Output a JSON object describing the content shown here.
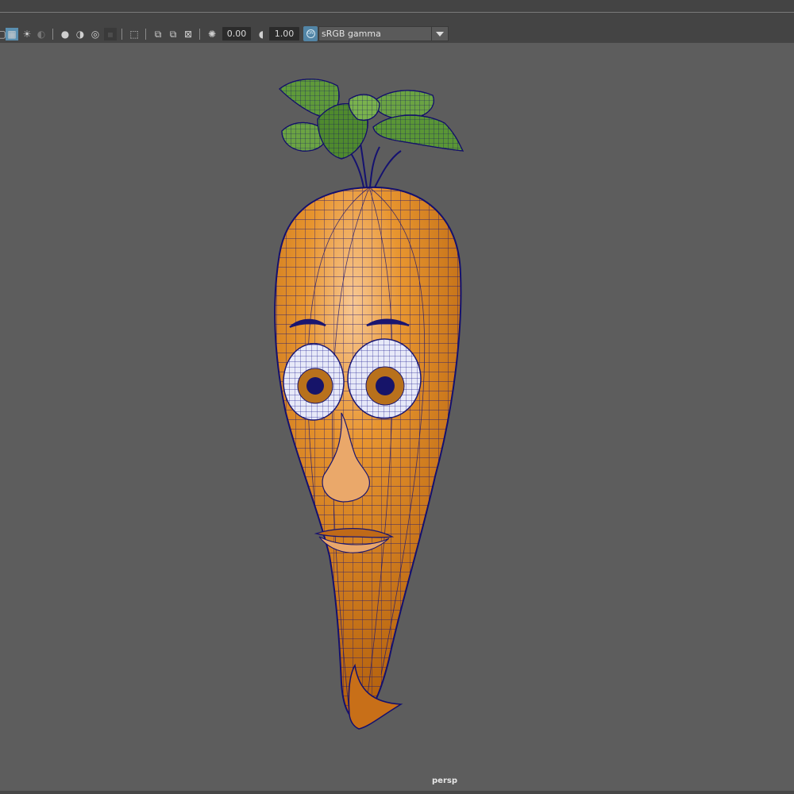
{
  "toolbar": {
    "exposure_value": "0.00",
    "gamma_value": "1.00",
    "color_space": "sRGB gamma",
    "icons": [
      "wireframe-icon",
      "checker-icon",
      "light-icon",
      "shadow-icon",
      "ambient-occlusion-icon",
      "motion-blur-icon",
      "antialias-icon",
      "depth-of-field-icon",
      "isolate-icon",
      "xray-icon",
      "xray-joints-icon",
      "xray-active-icon",
      "backface-icon",
      "exposure-icon",
      "gamma-icon",
      "color-management-icon"
    ]
  },
  "viewport": {
    "camera": "persp"
  },
  "colors": {
    "background": "#5d5d5d",
    "carrot": "#e08a2a",
    "wire": "#14117a",
    "leaves": "#5f9a3a",
    "iris": "#b86a12"
  }
}
